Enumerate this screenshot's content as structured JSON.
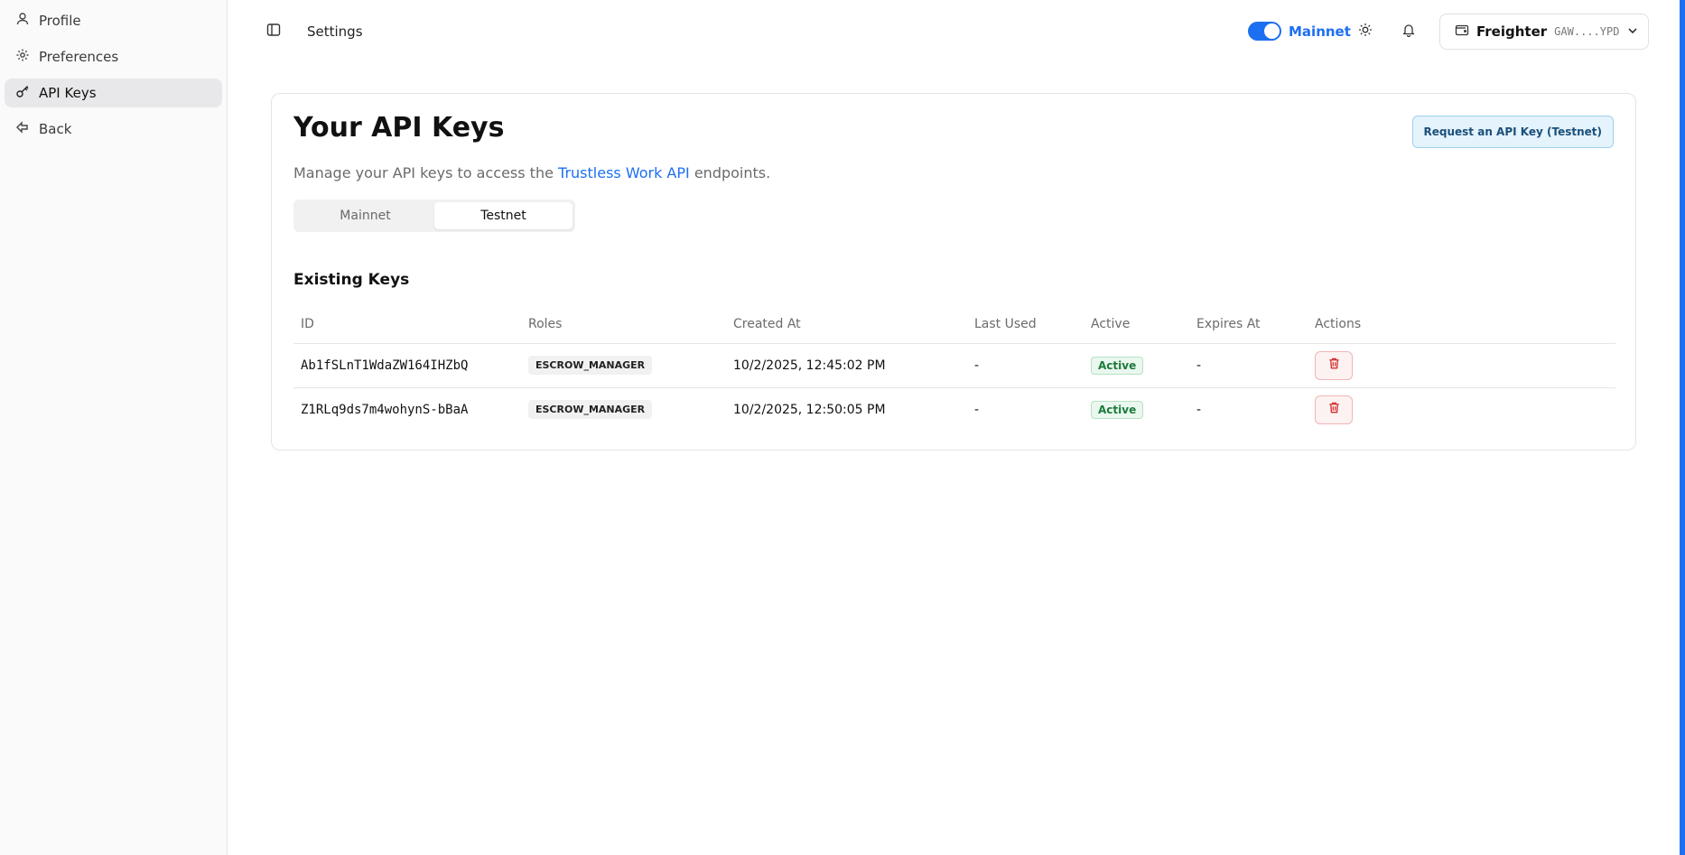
{
  "sidebar": {
    "items": [
      {
        "label": "Profile",
        "icon": "user-icon"
      },
      {
        "label": "Preferences",
        "icon": "gear-icon"
      },
      {
        "label": "API Keys",
        "icon": "key-icon"
      },
      {
        "label": "Back",
        "icon": "back-arrow-icon"
      }
    ],
    "active_index": 2
  },
  "topbar": {
    "title": "Settings",
    "network_label": "Mainnet",
    "network_enabled": true,
    "wallet": {
      "name": "Freighter",
      "address": "GAW....YPD"
    }
  },
  "card": {
    "title": "Your API Keys",
    "subtitle_prefix": "Manage your API keys to access the ",
    "subtitle_link": "Trustless Work API",
    "subtitle_suffix": " endpoints.",
    "request_button": "Request an API Key (Testnet)",
    "tabs": [
      {
        "label": "Mainnet"
      },
      {
        "label": "Testnet"
      }
    ],
    "active_tab": 1,
    "section_title": "Existing Keys",
    "table": {
      "headers": {
        "id": "ID",
        "roles": "Roles",
        "created": "Created At",
        "last_used": "Last Used",
        "active": "Active",
        "expires": "Expires At",
        "actions": "Actions"
      },
      "rows": [
        {
          "id": "Ab1fSLnT1WdaZW164IHZbQ",
          "role": "ESCROW_MANAGER",
          "created": "10/2/2025, 12:45:02 PM",
          "last_used": "-",
          "active": "Active",
          "expires": "-"
        },
        {
          "id": "Z1RLq9ds7m4wohynS-bBaA",
          "role": "ESCROW_MANAGER",
          "created": "10/2/2025, 12:50:05 PM",
          "last_used": "-",
          "active": "Active",
          "expires": "-"
        }
      ]
    }
  },
  "colors": {
    "accent": "#1d6ff2",
    "danger": "#d32f2f",
    "success": "#1d7a3e"
  }
}
